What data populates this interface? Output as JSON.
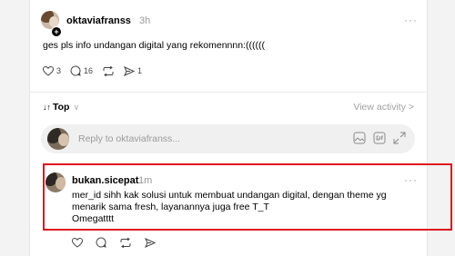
{
  "post": {
    "username": "oktaviafranss",
    "time": "3h",
    "more": "···",
    "text": "ges pls info undangan digital yang rekomennnn:((((((",
    "likes": "3",
    "comments": "16",
    "shares": "1"
  },
  "sort": {
    "icon": "↓↑",
    "label": "Top",
    "chevron": "∨"
  },
  "view_activity": "View activity >",
  "reply": {
    "placeholder": "Reply to oktaviafranss..."
  },
  "comment": {
    "username": "bukan.sicepat",
    "time": "1m",
    "more": "···",
    "lines": [
      "mer_id sihh kak solusi untuk membuat undangan digital, dengan theme yg",
      "menarik sama fresh, layanannya juga free T_T",
      "Omegatttt"
    ]
  },
  "colors": {
    "highlight_border": "#e0181b",
    "muted": "#9a9a9a"
  },
  "icons": [
    "heart-icon",
    "comment-icon",
    "repost-icon",
    "share-icon",
    "image-icon",
    "gif-icon",
    "expand-icon",
    "plus-icon"
  ]
}
